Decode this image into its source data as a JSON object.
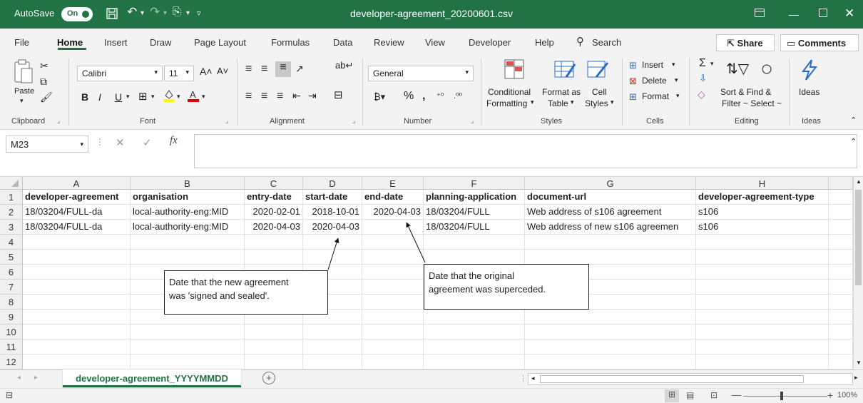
{
  "titlebar": {
    "autosave_label": "AutoSave",
    "autosave_state": "On",
    "document_title": "developer-agreement_20200601.csv"
  },
  "menu": {
    "tabs": [
      "File",
      "Home",
      "Insert",
      "Draw",
      "Page Layout",
      "Formulas",
      "Data",
      "Review",
      "View",
      "Developer",
      "Help"
    ],
    "search_label": "Search",
    "share_label": "Share",
    "comments_label": "Comments"
  },
  "ribbon": {
    "clipboard": {
      "paste_label": "Paste",
      "group_label": "Clipboard"
    },
    "font": {
      "font_name": "Calibri",
      "font_size": "11",
      "bold": "B",
      "italic": "I",
      "underline": "U",
      "group_label": "Font"
    },
    "alignment": {
      "group_label": "Alignment"
    },
    "number": {
      "format": "General",
      "group_label": "Number"
    },
    "styles": {
      "conditional_line1": "Conditional",
      "conditional_line2": "Formatting",
      "format_table_line1": "Format as",
      "format_table_line2": "Table",
      "cell_styles_line1": "Cell",
      "cell_styles_line2": "Styles",
      "group_label": "Styles"
    },
    "cells": {
      "insert": "Insert",
      "delete": "Delete",
      "format": "Format",
      "group_label": "Cells"
    },
    "editing": {
      "sort_line1": "Sort & Find &",
      "sort_line2": "Filter ~ Select ~",
      "group_label": "Editing"
    },
    "ideas": {
      "label": "Ideas",
      "group_label": "Ideas"
    }
  },
  "formula_bar": {
    "name_box": "M23",
    "fx": "fx",
    "value": ""
  },
  "grid": {
    "columns": [
      "A",
      "B",
      "C",
      "D",
      "E",
      "F",
      "G",
      "H"
    ],
    "rows": [
      "1",
      "2",
      "3",
      "4",
      "5",
      "6",
      "7",
      "8",
      "9",
      "10",
      "11",
      "12"
    ],
    "header_row": [
      "developer-agreement",
      "organisation",
      "entry-date",
      "start-date",
      "end-date",
      "planning-application",
      "document-url",
      "developer-agreement-type"
    ],
    "data_rows": [
      [
        "18/03204/FULL-da",
        "local-authority-eng:MID",
        "2020-02-01",
        "2018-10-01",
        "2020-04-03",
        "18/03204/FULL",
        "Web address of s106 agreement",
        "s106"
      ],
      [
        "18/03204/FULL-da",
        "local-authority-eng:MID",
        "2020-04-03",
        "2020-04-03",
        "",
        "18/03204/FULL",
        "Web address of new s106 agreemen",
        "s106"
      ]
    ]
  },
  "callouts": {
    "left": [
      "Date that the new agreement",
      "was 'signed and sealed'."
    ],
    "right": [
      "Date that the original",
      "agreement was superceded."
    ]
  },
  "sheets": {
    "active": "developer-agreement_YYYYMMDD",
    "add": "+"
  },
  "statusbar": {
    "zoom": "100%"
  }
}
